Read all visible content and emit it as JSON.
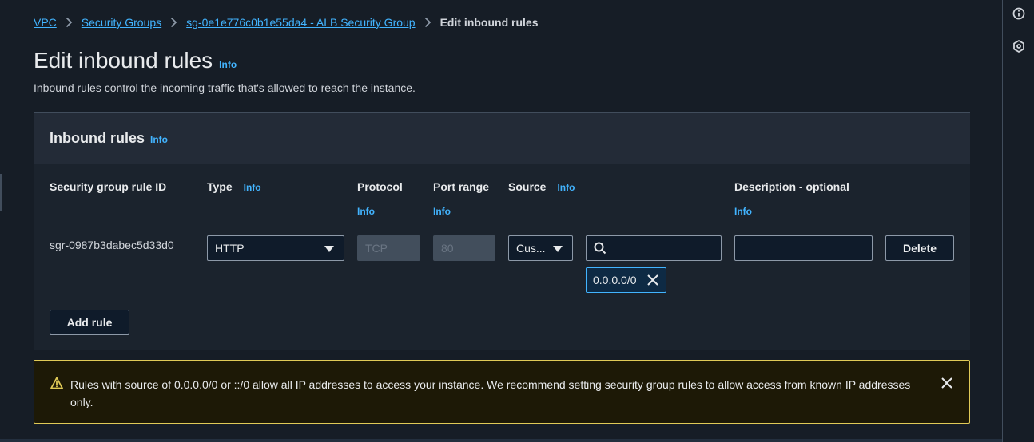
{
  "breadcrumb": {
    "items": [
      "VPC",
      "Security Groups",
      "sg-0e1e776c0b1e55da4 - ALB Security Group"
    ],
    "current": "Edit inbound rules"
  },
  "page": {
    "title": "Edit inbound rules",
    "info": "Info",
    "description": "Inbound rules control the incoming traffic that's allowed to reach the instance."
  },
  "panel": {
    "title": "Inbound rules",
    "info": "Info",
    "columns": {
      "rule_id": "Security group rule ID",
      "type": "Type",
      "protocol": "Protocol",
      "port_range": "Port range",
      "source": "Source",
      "description": "Description - optional",
      "info": "Info"
    },
    "rule": {
      "id": "sgr-0987b3dabec5d33d0",
      "type": "HTTP",
      "protocol": "TCP",
      "port_range": "80",
      "source_type": "Cus...",
      "source_search": "",
      "source_token": "0.0.0.0/0",
      "description": ""
    },
    "delete_label": "Delete",
    "add_rule_label": "Add rule"
  },
  "alert": {
    "text": "Rules with source of 0.0.0.0/0 or ::/0 allow all IP addresses to access your instance. We recommend setting security group rules to allow access from known IP addresses only."
  },
  "colors": {
    "background": "#161d26",
    "link": "#42b4ff",
    "warning_border": "#e0ca57",
    "warning_background": "#1d1906"
  },
  "icons": {
    "rail_top": "info-circle-icon",
    "rail_second": "hexagon-settings-icon",
    "alert": "warning-triangle-icon"
  }
}
